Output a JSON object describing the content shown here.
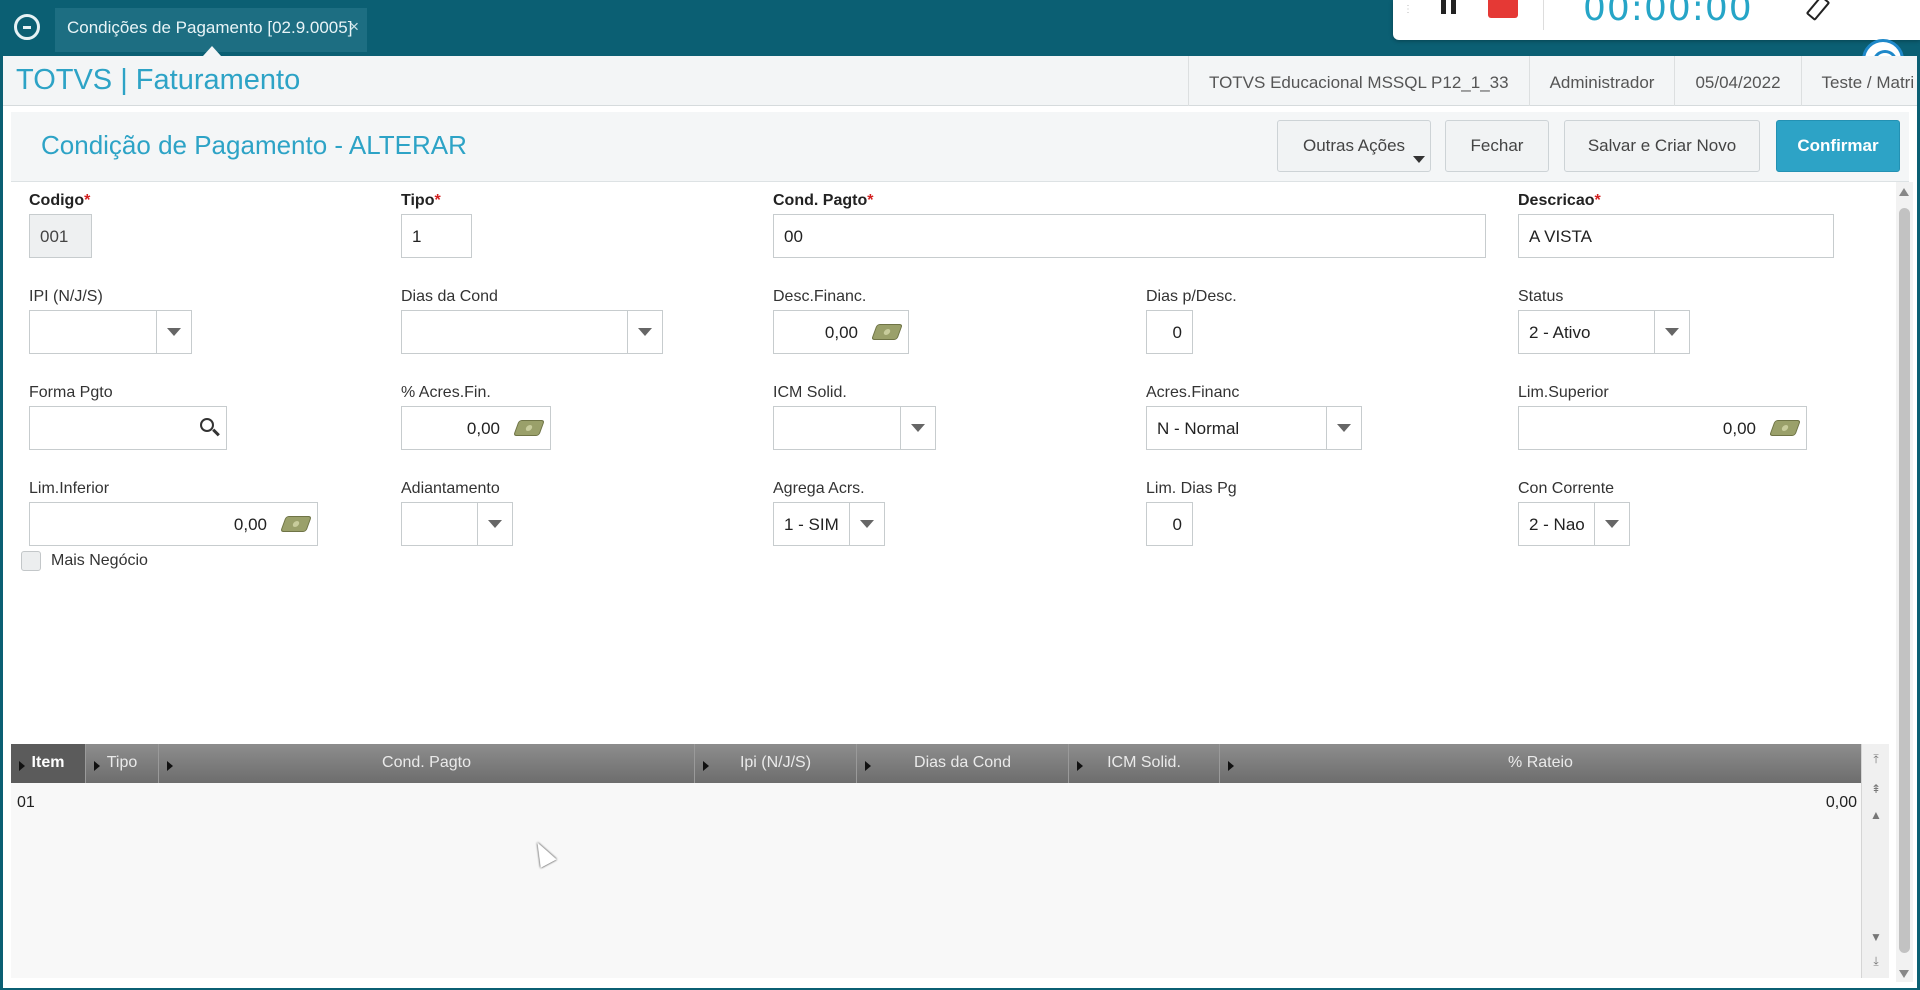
{
  "tab": {
    "title": "Condições de Pagamento [02.9.0005]",
    "close": "×"
  },
  "recorder": {
    "timer": "00:00:00"
  },
  "header": {
    "brand": "TOTVS | Faturamento",
    "environment": "TOTVS Educacional MSSQL P12_1_33",
    "user": "Administrador",
    "date": "05/04/2022",
    "branch": "Teste / Matri"
  },
  "page": {
    "title": "Condição de Pagamento - ALTERAR",
    "buttons": {
      "outras_acoes": "Outras Ações",
      "fechar": "Fechar",
      "salvar_criar": "Salvar e Criar Novo",
      "confirmar": "Confirmar"
    }
  },
  "form": {
    "codigo": {
      "label": "Codigo",
      "value": "001"
    },
    "tipo": {
      "label": "Tipo",
      "value": "1"
    },
    "cond_pagto": {
      "label": "Cond. Pagto",
      "value": "00"
    },
    "descricao": {
      "label": "Descricao",
      "value": "A VISTA"
    },
    "ipi": {
      "label": "IPI (N/J/S)",
      "value": ""
    },
    "dias_cond": {
      "label": "Dias da Cond",
      "value": ""
    },
    "desc_financ": {
      "label": "Desc.Financ.",
      "value": "0,00"
    },
    "dias_desc": {
      "label": "Dias p/Desc.",
      "value": "0"
    },
    "status": {
      "label": "Status",
      "value": "2 - Ativo"
    },
    "forma_pgto": {
      "label": "Forma Pgto",
      "value": ""
    },
    "acres_fin": {
      "label": "% Acres.Fin.",
      "value": "0,00"
    },
    "icm_solid": {
      "label": "ICM Solid.",
      "value": ""
    },
    "acres_financ": {
      "label": "Acres.Financ",
      "value": "N - Normal"
    },
    "lim_superior": {
      "label": "Lim.Superior",
      "value": "0,00"
    },
    "lim_inferior": {
      "label": "Lim.Inferior",
      "value": "0,00"
    },
    "adiantamento": {
      "label": "Adiantamento",
      "value": ""
    },
    "agrega_acrs": {
      "label": "Agrega Acrs.",
      "value": "1 - SIM"
    },
    "lim_dias_pg": {
      "label": "Lim. Dias Pg",
      "value": "0"
    },
    "con_corrente": {
      "label": "Con Corrente",
      "value": "2 - Nao"
    },
    "mais_negocio": {
      "label": "Mais Negócio",
      "checked": false
    }
  },
  "grid": {
    "columns": [
      "Item",
      "Tipo",
      "Cond. Pagto",
      "Ipi (N/J/S)",
      "Dias da Cond",
      "ICM Solid.",
      "% Rateio"
    ],
    "rows": [
      {
        "item": "01",
        "rateio": "0,00"
      }
    ]
  }
}
